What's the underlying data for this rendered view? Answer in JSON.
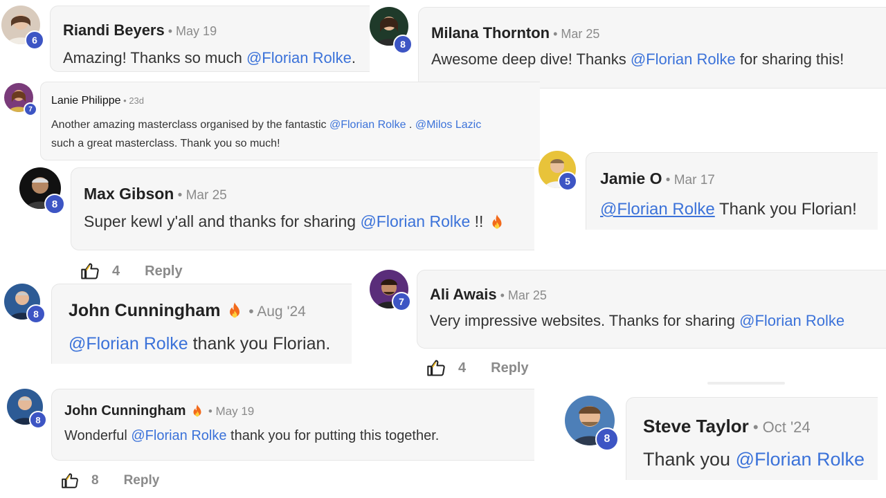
{
  "comments": [
    {
      "name": "Riandi Beyers",
      "date": "May 19",
      "badge": "6",
      "pre": "Amazing! Thanks so much ",
      "mention": "@Florian Rolke",
      "post": "."
    },
    {
      "name": "Milana Thornton",
      "date": "Mar 25",
      "badge": "8",
      "pre": "Awesome deep dive! Thanks ",
      "mention": "@Florian Rolke",
      "post": " for sharing this!"
    },
    {
      "name": "Lanie Philippe",
      "date": "23d",
      "badge": "7",
      "pre": "Another amazing masterclass organised by the fantastic ",
      "mention": "@Florian Rolke",
      "mid": " . ",
      "mention2": "@Milos Lazic",
      "line2": "such a great masterclass. Thank you so much!"
    },
    {
      "name": "Max Gibson",
      "date": "Mar 25",
      "badge": "8",
      "pre": "Super kewl y'all and thanks for sharing ",
      "mention": "@Florian Rolke",
      "post": " !! "
    },
    {
      "name": "Jamie O",
      "date": "Mar 17",
      "badge": "5",
      "pre": "",
      "mention": "@Florian Rolke",
      "post": " Thank you Florian! "
    },
    {
      "name": "John Cunningham",
      "date": "Aug '24",
      "badge": "8",
      "pre": "",
      "mention": "@Florian Rolke",
      "post": " thank you Florian."
    },
    {
      "name": "Ali Awais",
      "date": "Mar 25",
      "badge": "7",
      "pre": "Very impressive websites. Thanks for sharing ",
      "mention": "@Florian Rolke",
      "post": ""
    },
    {
      "name": "John Cunningham",
      "date": "May 19",
      "badge": "8",
      "pre": "Wonderful ",
      "mention": "@Florian Rolke",
      "post": " thank you for putting this together."
    },
    {
      "name": "Steve Taylor",
      "date": "Oct '24",
      "badge": "8",
      "pre": "Thank you ",
      "mention": "@Florian Rolke",
      "post": ""
    }
  ],
  "actions": [
    {
      "count": "4",
      "reply": "Reply"
    },
    {
      "count": "4",
      "reply": "Reply"
    },
    {
      "count": "8",
      "reply": "Reply"
    }
  ],
  "separator": " • ",
  "icons": {
    "like": "thumbs-up-icon",
    "fire": "fire-emoji-icon"
  },
  "colors": {
    "mention": "#3b72d9",
    "badge": "#3d55c4",
    "bubble": "#f6f6f6"
  }
}
